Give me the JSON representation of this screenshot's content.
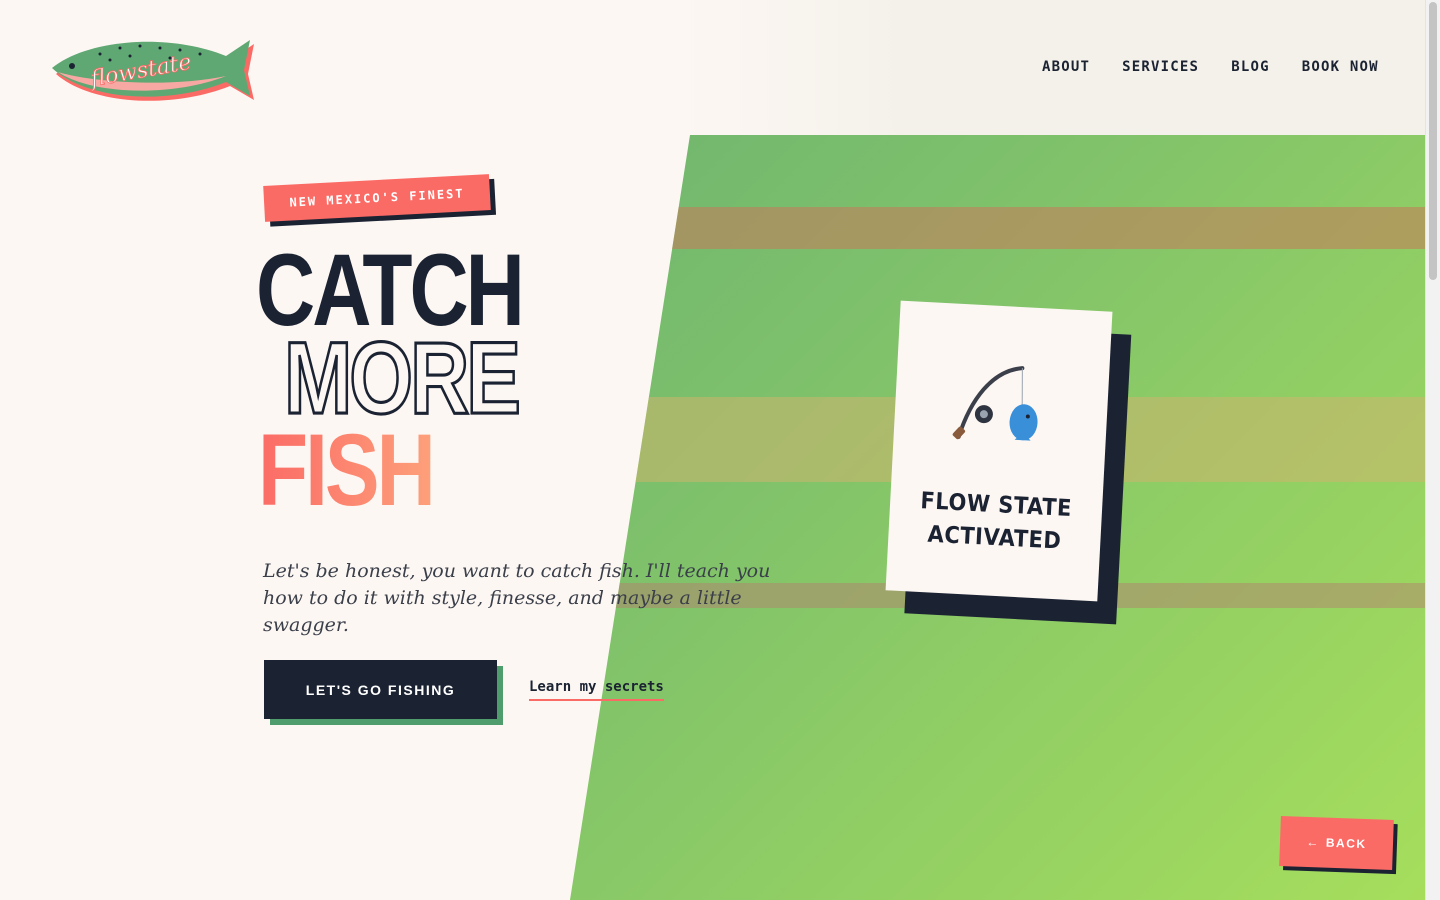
{
  "brand": {
    "logo_text": "flowstate",
    "logo_icon": "trout-icon"
  },
  "nav": {
    "items": [
      {
        "label": "ABOUT"
      },
      {
        "label": "SERVICES"
      },
      {
        "label": "BLOG"
      },
      {
        "label": "BOOK NOW"
      }
    ]
  },
  "hero": {
    "tag": "NEW MEXICO'S FINEST",
    "headline_1": "CATCH",
    "headline_2": "MORE",
    "headline_3": "FISH",
    "lede": "Let's be honest, you want to catch fish. I'll teach you how to do it with style, finesse, and maybe a little swagger.",
    "cta_label": "LET'S GO FISHING",
    "link_label": "Learn my secrets"
  },
  "card": {
    "icon": "fishing-pole-icon",
    "label_1": "FLOW STATE",
    "label_2": "ACTIVATED"
  },
  "back": {
    "arrow": "←",
    "label": "BACK"
  },
  "colors": {
    "navy": "#1b2333",
    "coral": "#fb6b66",
    "green": "#5fa873",
    "lime": "#a6de5c",
    "cream": "#fdf7f3"
  }
}
